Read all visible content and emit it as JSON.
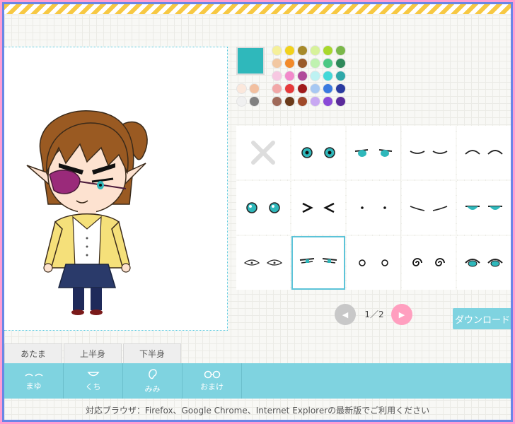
{
  "palette": {
    "current": "#2fb8bb",
    "grid": [
      "#f5f09a",
      "#f2d21c",
      "#a78a2a",
      "#d7f29a",
      "#a8d82c",
      "#7bb84a",
      "#f2c8a2",
      "#f28a2a",
      "#9a5a2a",
      "#bff2b0",
      "#4cc884",
      "#2f8a5a",
      "#f7c8e2",
      "#f28acb",
      "#b04a9a",
      "#bdf2f2",
      "#44d8d8",
      "#2fa8a8",
      "#f2a8a8",
      "#e63a3a",
      "#a01a1a",
      "#a8c8f2",
      "#3a7ae0",
      "#2a3aa0",
      "#a06a5a",
      "#6a3a1a",
      "#a04a2a",
      "#c8a8f2",
      "#8a4ad8",
      "#5a2a9a"
    ],
    "left": [
      "#fbe8dc",
      "#f0f0f0"
    ],
    "left2": [
      "#f2c0a0",
      "#808080"
    ],
    "left3": [
      "#d0a080",
      "#404040"
    ]
  },
  "parts": {
    "items": [
      {
        "name": "part-none",
        "kind": "none"
      },
      {
        "name": "part-eyes-1",
        "kind": "eyes-round"
      },
      {
        "name": "part-eyes-2",
        "kind": "eyes-wide"
      },
      {
        "name": "part-eyes-closed-1",
        "kind": "closed-down"
      },
      {
        "name": "part-eyes-closed-2",
        "kind": "closed-up"
      },
      {
        "name": "part-eyes-3",
        "kind": "eyes-sparkle"
      },
      {
        "name": "part-eyes-squint",
        "kind": "squint"
      },
      {
        "name": "part-eyes-dots",
        "kind": "dots"
      },
      {
        "name": "part-eyes-lines",
        "kind": "lines"
      },
      {
        "name": "part-eyes-half",
        "kind": "half"
      },
      {
        "name": "part-eyes-blank",
        "kind": "blank"
      },
      {
        "name": "part-eyes-glare",
        "kind": "glare"
      },
      {
        "name": "part-eyes-circles",
        "kind": "circles"
      },
      {
        "name": "part-eyes-swirl",
        "kind": "swirl"
      },
      {
        "name": "part-eyes-teary",
        "kind": "teary"
      }
    ],
    "selected_index": 11
  },
  "pager": {
    "text": "1／2"
  },
  "download_label": "ダウンロード",
  "tabs": [
    "あたま",
    "上半身",
    "下半身"
  ],
  "categories": [
    {
      "label": "まゆ",
      "icon": "eyebrow-icon"
    },
    {
      "label": "くち",
      "icon": "mouth-icon"
    },
    {
      "label": "みみ",
      "icon": "ear-icon"
    },
    {
      "label": "おまけ",
      "icon": "glasses-icon"
    }
  ],
  "footer": "対応ブラウザ：Firefox、Google Chrome、Internet Explorerの最新版でご利用ください"
}
